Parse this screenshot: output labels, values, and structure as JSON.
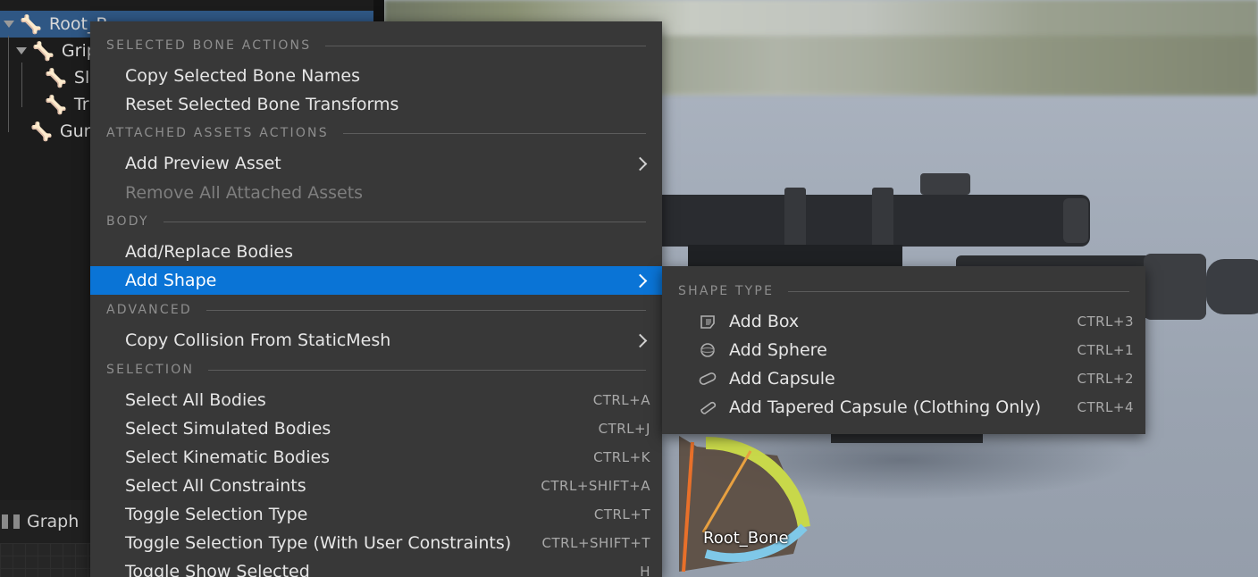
{
  "tree": {
    "rows": [
      {
        "label": "Root_B",
        "selected": true
      },
      {
        "label": "Grip"
      },
      {
        "label": "Sli"
      },
      {
        "label": "Tri"
      },
      {
        "label": "Gun"
      }
    ]
  },
  "graph_tab": {
    "label": "Graph"
  },
  "context_menu": {
    "sections": {
      "selected_bone_actions": "SELECTED BONE ACTIONS",
      "attached_assets_actions": "ATTACHED ASSETS ACTIONS",
      "body": "BODY",
      "advanced": "ADVANCED",
      "selection": "SELECTION"
    },
    "items": {
      "copy_bone_names": "Copy Selected Bone Names",
      "reset_bone_transforms": "Reset Selected Bone Transforms",
      "add_preview_asset": "Add Preview Asset",
      "remove_attached_assets": "Remove All Attached Assets",
      "add_replace_bodies": "Add/Replace Bodies",
      "add_shape": "Add Shape",
      "copy_collision": "Copy Collision From StaticMesh",
      "select_all_bodies": "Select All Bodies",
      "select_simulated_bodies": "Select Simulated Bodies",
      "select_kinematic_bodies": "Select Kinematic Bodies",
      "select_all_constraints": "Select All Constraints",
      "toggle_selection_type": "Toggle Selection Type",
      "toggle_selection_type_user": "Toggle Selection Type (With User Constraints)",
      "toggle_show_selected": "Toggle Show Selected"
    },
    "shortcuts": {
      "select_all_bodies": "CTRL+A",
      "select_simulated_bodies": "CTRL+J",
      "select_kinematic_bodies": "CTRL+K",
      "select_all_constraints": "CTRL+SHIFT+A",
      "toggle_selection_type": "CTRL+T",
      "toggle_selection_type_user": "CTRL+SHIFT+T",
      "toggle_show_selected": "H"
    }
  },
  "shape_submenu": {
    "section": "SHAPE TYPE",
    "items": [
      {
        "label": "Add Box",
        "shortcut": "CTRL+3",
        "icon": "box-shape-icon"
      },
      {
        "label": "Add Sphere",
        "shortcut": "CTRL+1",
        "icon": "sphere-shape-icon"
      },
      {
        "label": "Add Capsule",
        "shortcut": "CTRL+2",
        "icon": "capsule-shape-icon"
      },
      {
        "label": "Add Tapered Capsule (Clothing Only)",
        "shortcut": "CTRL+4",
        "icon": "tapered-capsule-shape-icon"
      }
    ]
  },
  "viewport": {
    "bone_label": "Root_Bone"
  },
  "colors": {
    "highlight": "#0a74d6",
    "menu_bg": "#383838",
    "selected_row": "#2f5784"
  }
}
